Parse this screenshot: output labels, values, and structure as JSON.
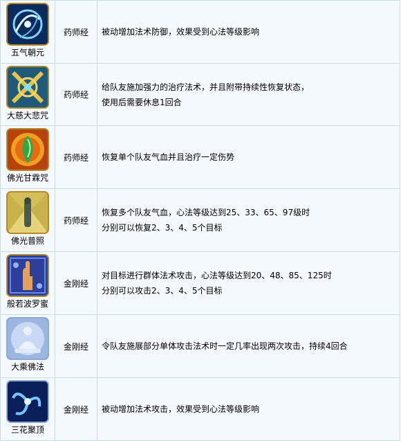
{
  "skills": [
    {
      "name": "五气朝元",
      "class": "药师经",
      "lines": [
        "被动增加法术防御，效果受到心法等级影响"
      ]
    },
    {
      "name": "大慈大悲咒",
      "class": "药师经",
      "lines": [
        "给队友施加强力的治疗法术，并且附带持续性恢复状态，",
        "使用后需要休息1回合"
      ]
    },
    {
      "name": "佛光甘霖咒",
      "class": "药师经",
      "lines": [
        "恢复单个队友气血并且治疗一定伤势"
      ]
    },
    {
      "name": "佛光普照",
      "class": "药师经",
      "lines": [
        "恢复多个队友气血，心法等级达到25、33、65、97级时",
        "分别可以恢复2、3、4、5个目标"
      ]
    },
    {
      "name": "般若波罗蜜",
      "class": "金刚经",
      "lines": [
        "对目标进行群体法术攻击，心法等级达到20、48、85、125时",
        "分别可以攻击2、3、4、5个目标"
      ]
    },
    {
      "name": "大乘佛法",
      "class": "金刚经",
      "lines": [
        "令队友施展部分单体攻击法术时一定几率出现两次攻击，持续4回合"
      ]
    },
    {
      "name": "三花聚顶",
      "class": "金刚经",
      "lines": [
        "被动增加法术攻击，效果受到心法等级影响"
      ]
    }
  ],
  "icons": [
    "swirl-energy-icon",
    "golden-cross-icon",
    "green-gem-icon",
    "buddha-statue-icon",
    "raised-hand-icon",
    "meditating-figure-icon",
    "spiral-flower-icon"
  ]
}
